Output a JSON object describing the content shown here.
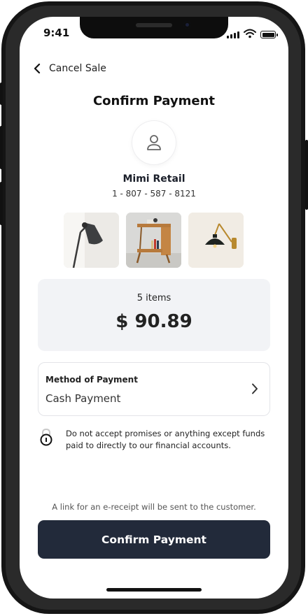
{
  "status_bar": {
    "time": "9:41"
  },
  "nav": {
    "back_label": "Cancel Sale"
  },
  "page": {
    "title": "Confirm Payment"
  },
  "merchant": {
    "name": "Mimi Retail",
    "phone": "1 - 807 - 587 - 8121"
  },
  "products": [
    {
      "icon": "desk-lamp-image"
    },
    {
      "icon": "side-table-image"
    },
    {
      "icon": "wall-lamp-image"
    }
  ],
  "summary": {
    "items_count": "5 items",
    "total": "$ 90.89"
  },
  "payment_method": {
    "label": "Method of Payment",
    "value": "Cash Payment"
  },
  "warning": {
    "text": "Do not accept promises or anything except funds paid to directly to our financial accounts."
  },
  "footer": {
    "ereceipt_note": "A link for an e-receipt will be sent to the customer.",
    "confirm_label": "Confirm Payment"
  },
  "colors": {
    "primary_button": "#222a3a",
    "summary_bg": "#f2f3f6"
  }
}
